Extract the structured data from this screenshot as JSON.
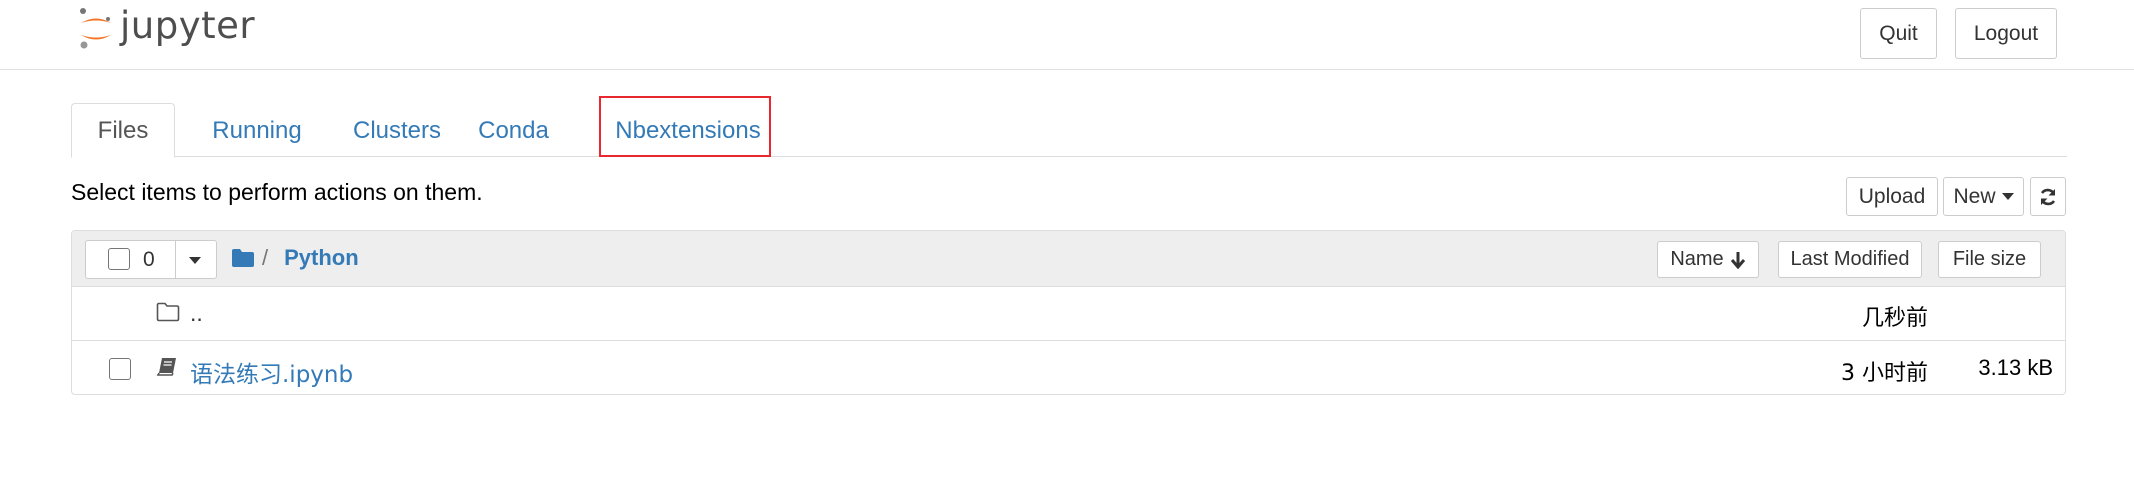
{
  "header": {
    "logo_text": "jupyter",
    "quit_label": "Quit",
    "logout_label": "Logout"
  },
  "tabs": [
    {
      "label": "Files",
      "active": true
    },
    {
      "label": "Running",
      "active": false
    },
    {
      "label": "Clusters",
      "active": false
    },
    {
      "label": "Conda",
      "active": false
    },
    {
      "label": "Nbextensions",
      "active": false,
      "highlighted": true
    }
  ],
  "toolbar": {
    "hint": "Select items to perform actions on them.",
    "upload_label": "Upload",
    "new_label": "New"
  },
  "list_header": {
    "selected_count": "0",
    "breadcrumb_sep": "/",
    "current_folder": "Python",
    "sort_name_label": "Name",
    "sort_modified_label": "Last Modified",
    "sort_size_label": "File size"
  },
  "items": [
    {
      "name": "..",
      "type": "parent-folder",
      "modified": "几秒前",
      "size": ""
    },
    {
      "name": "语法练习.ipynb",
      "type": "notebook",
      "modified": "3 小时前",
      "size": "3.13 kB"
    }
  ],
  "colors": {
    "link": "#337ab7",
    "highlight_border": "#e8272f",
    "logo_orange": "#f37726"
  }
}
